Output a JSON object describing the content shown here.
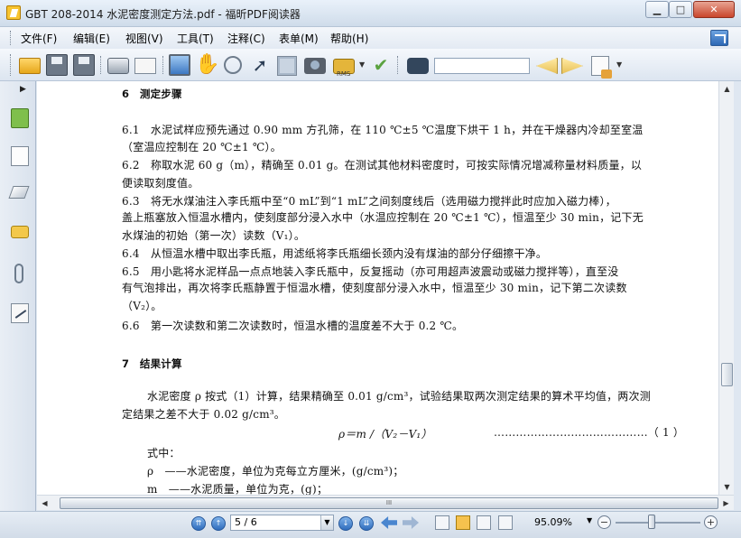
{
  "window": {
    "title": "GBT 208-2014 水泥密度测定方法.pdf - 福昕PDF阅读器",
    "minimize": "▁",
    "maximize": "□",
    "close": "✕"
  },
  "menu": {
    "items": [
      "文件(F)",
      "编辑(E)",
      "视图(V)",
      "工具(T)",
      "注释(C)",
      "表单(M)",
      "帮助(H)"
    ]
  },
  "toolbar": {
    "icons": [
      "folder-open-icon",
      "save-icon",
      "save-as-icon",
      "print-icon",
      "card-icon",
      "fullscreen-icon",
      "hand-icon",
      "zoom-text-icon",
      "cursor-icon",
      "select-text-icon",
      "snapshot-icon",
      "security-rms-icon",
      "sign-icon",
      "binoculars-icon",
      "prev-result-icon",
      "next-result-icon",
      "document-options-icon"
    ],
    "rms_label": "RMS",
    "search_value": ""
  },
  "sidebar": {
    "icons": [
      "bookmarks-icon",
      "pages-icon",
      "layers-icon",
      "comments-icon",
      "attachments-icon",
      "signatures-icon"
    ]
  },
  "document": {
    "lines": [
      "6　测定步骤",
      "6.1　水泥试样应预先通过 0.90 mm 方孔筛，在 110 ℃±5 ℃温度下烘干 1 h，并在干燥器内冷却至室温",
      "（室温应控制在 20 ℃±1 ℃）。",
      "6.2　称取水泥 60 g（m），精确至 0.01 g。在测试其他材料密度时，可按实际情况增减称量材料质量，以",
      "便读取刻度值。",
      "6.3　将无水煤油注入李氏瓶中至“0 mL”到“1 mL”之间刻度线后（选用磁力搅拌此时应加入磁力棒），",
      "盖上瓶塞放入恒温水槽内，使刻度部分浸入水中（水温应控制在 20 ℃±1 ℃），恒温至少 30 min，记下无",
      "水煤油的初始（第一次）读数（V₁）。",
      "6.4　从恒温水槽中取出李氏瓶，用滤纸将李氏瓶细长颈内没有煤油的部分仔细擦干净。",
      "6.5　用小匙将水泥样品一点点地装入李氏瓶中，反复摇动（亦可用超声波震动或磁力搅拌等），直至没",
      "有气泡排出，再次将李氏瓶静置于恒温水槽，使刻度部分浸入水中，恒温至少 30 min，记下第二次读数",
      "（V₂）。",
      "6.6　第一次读数和第二次读数时，恒温水槽的温度差不大于 0.2 ℃。",
      "7　结果计算",
      "水泥密度 ρ 按式（1）计算，结果精确至 0.01 g/cm³，试验结果取两次测定结果的算术平均值，两次测",
      "定结果之差不大于 0.02 g/cm³。",
      "ρ＝m /（V₂－V₁）",
      "……………………………………（ 1 ）",
      "式中：",
      "ρ　——水泥密度，单位为克每立方厘米，(g/cm³)；",
      "m　——水泥质量，单位为克，(g)；"
    ]
  },
  "statusbar": {
    "page": "5 / 6",
    "zoom": "95.09%",
    "first_page": "⇈",
    "prev_page": "↑",
    "next_page": "↓",
    "last_page": "⇊",
    "zoom_slider_value": 0.5
  },
  "scroll": {
    "hgrip": "III"
  }
}
